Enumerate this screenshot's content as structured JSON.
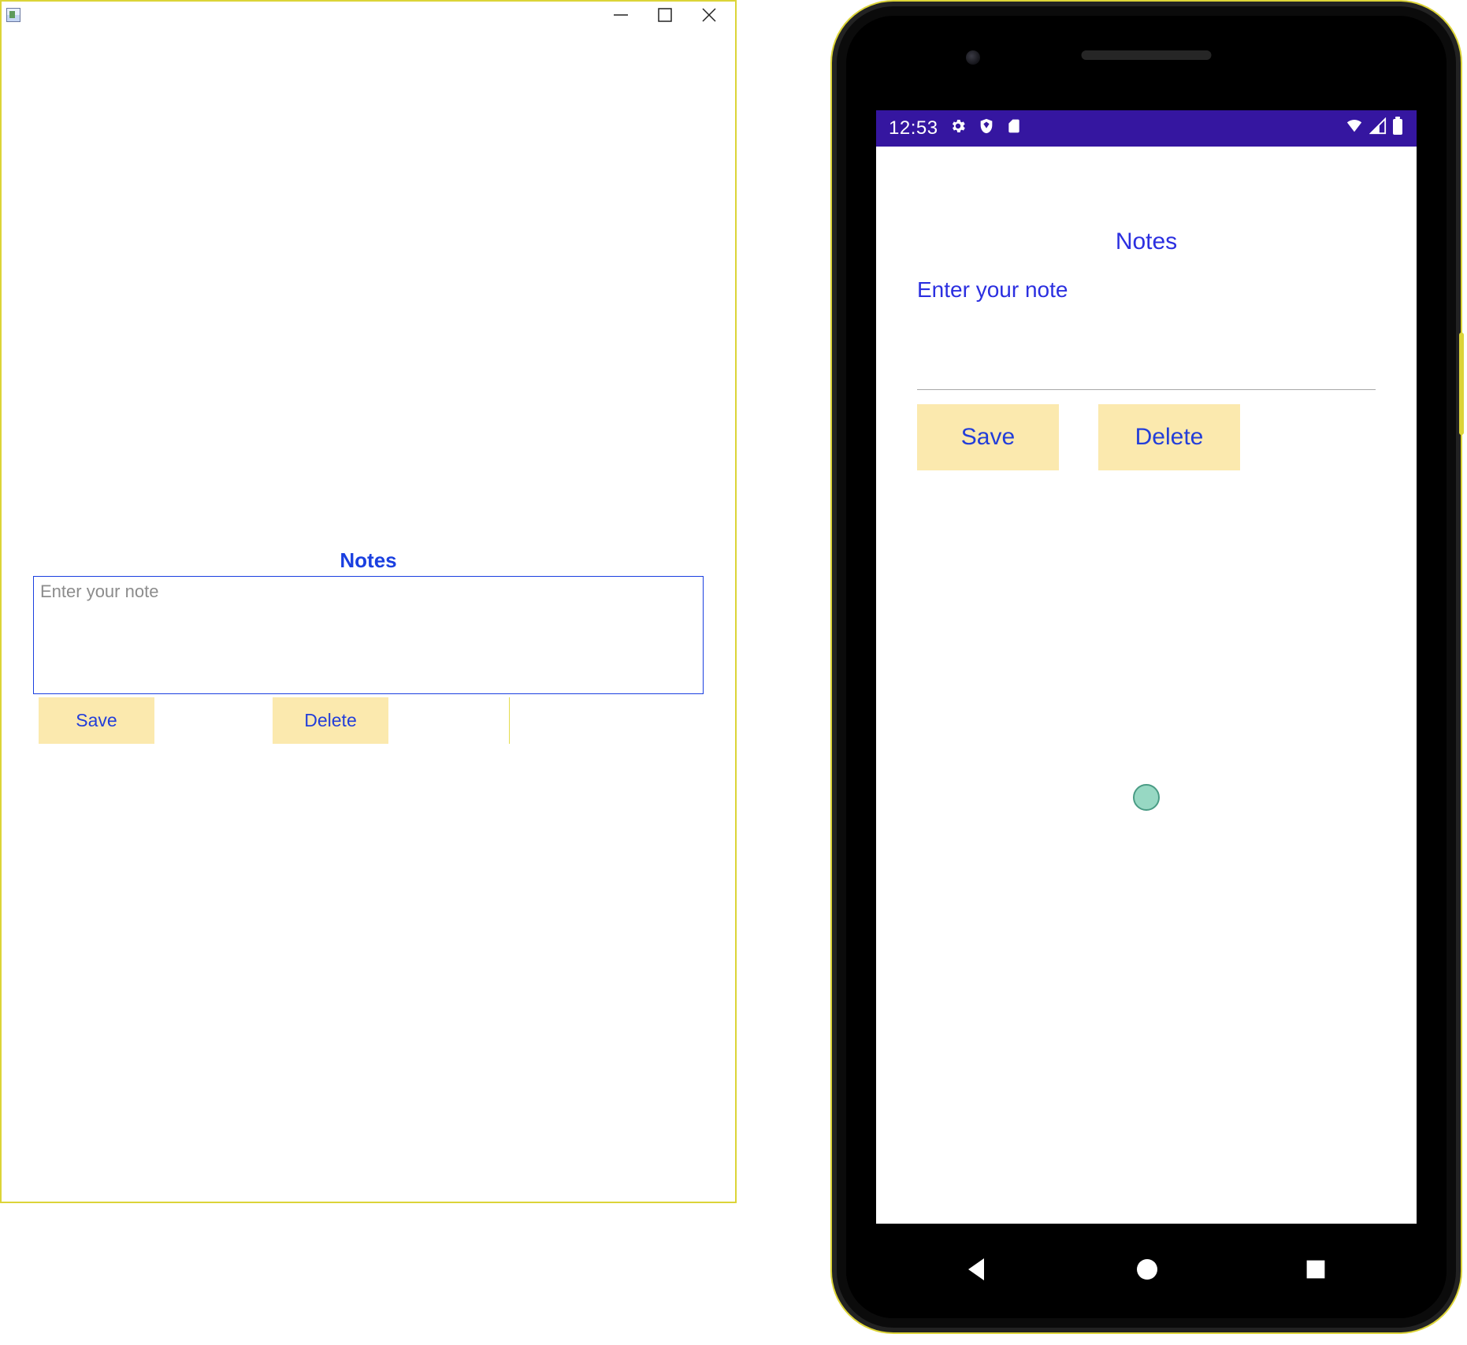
{
  "desktop": {
    "title": "Notes",
    "editor_placeholder": "Enter your note",
    "save_label": "Save",
    "delete_label": "Delete"
  },
  "phone": {
    "statusbar": {
      "time": "12:53"
    },
    "title": "Notes",
    "editor_placeholder": "Enter your note",
    "save_label": "Save",
    "delete_label": "Delete"
  }
}
